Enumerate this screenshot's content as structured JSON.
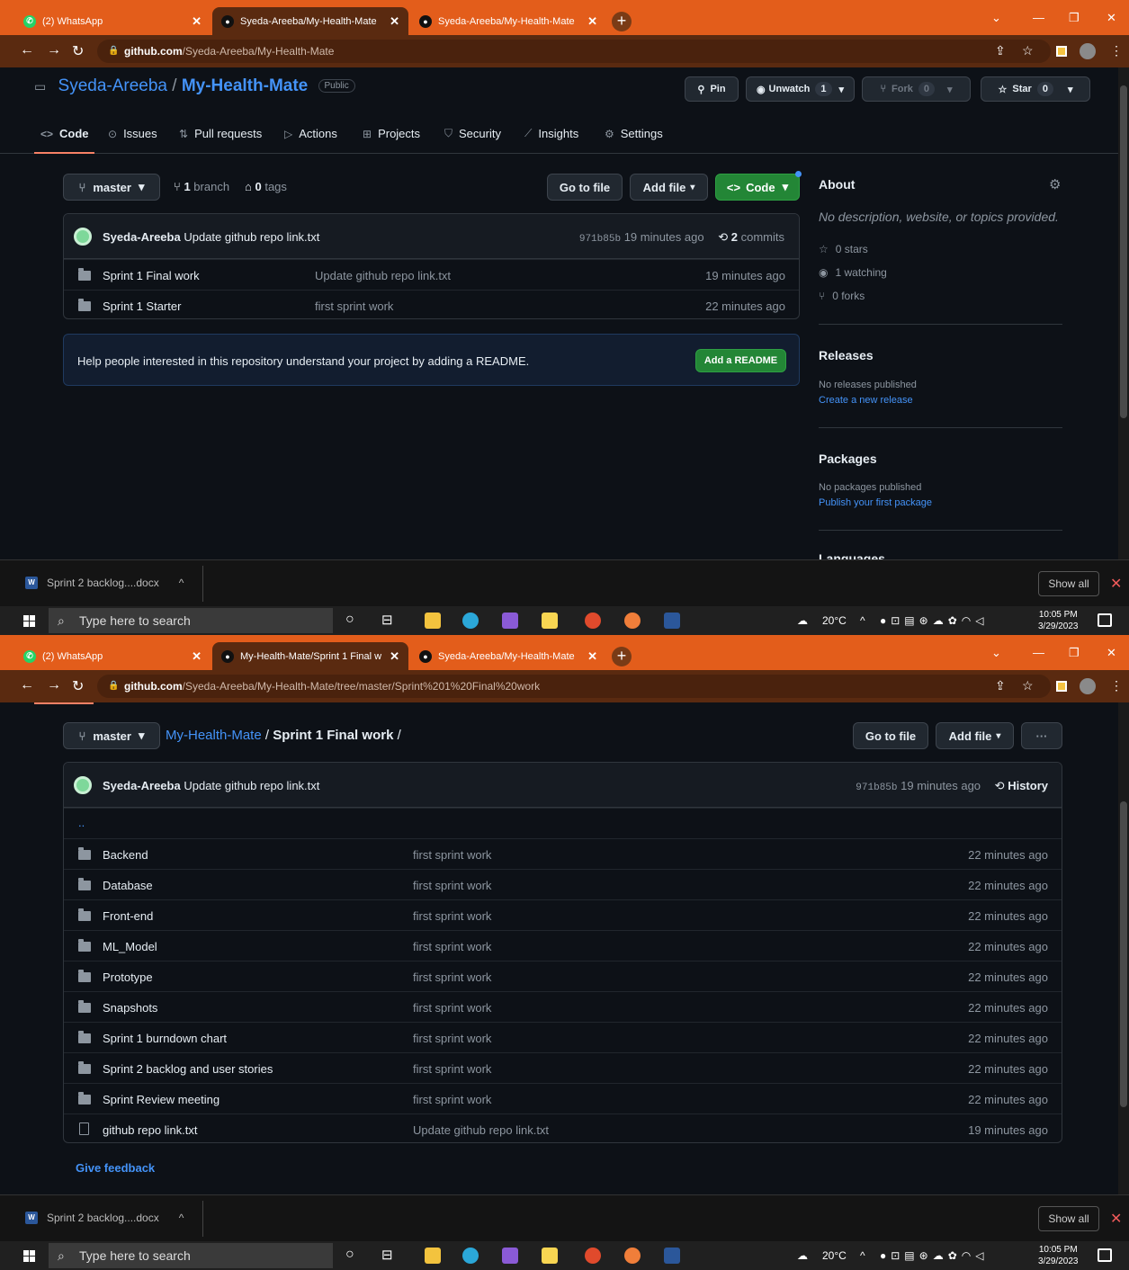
{
  "browser": {
    "tabs_shot1": [
      {
        "label": "(2) WhatsApp",
        "icon": "whatsapp-icon"
      },
      {
        "label": "Syeda-Areeba/My-Health-Mate",
        "icon": "github-icon"
      },
      {
        "label": "Syeda-Areeba/My-Health-Mate",
        "icon": "github-icon"
      }
    ],
    "tabs_shot2": [
      {
        "label": "(2) WhatsApp",
        "icon": "whatsapp-icon"
      },
      {
        "label": "My-Health-Mate/Sprint 1 Final w",
        "icon": "github-icon"
      },
      {
        "label": "Syeda-Areeba/My-Health-Mate",
        "icon": "github-icon"
      }
    ],
    "url1": {
      "host": "github.com",
      "path": "/Syeda-Areeba/My-Health-Mate"
    },
    "url2": {
      "host": "github.com",
      "path": "/Syeda-Areeba/My-Health-Mate/tree/master/Sprint%201%20Final%20work"
    }
  },
  "repo": {
    "owner": "Syeda-Areeba",
    "name": "My-Health-Mate",
    "visibility": "Public",
    "pin_label": "Pin",
    "unwatch_label": "Unwatch",
    "watch_count": "1",
    "fork_label": "Fork",
    "fork_count": "0",
    "star_label": "Star",
    "star_count": "0"
  },
  "repo_tabs": [
    "Code",
    "Issues",
    "Pull requests",
    "Actions",
    "Projects",
    "Security",
    "Insights",
    "Settings"
  ],
  "code_view": {
    "branch": "master",
    "branch_count": "1",
    "branch_label": "branch",
    "tag_count": "0",
    "tag_label": "tags",
    "go_to_file": "Go to file",
    "add_file": "Add file",
    "code_button": "Code",
    "latest_commit": {
      "author": "Syeda-Areeba",
      "message": "Update github repo link.txt",
      "sha": "971b85b",
      "time": "19 minutes ago",
      "commit_count": "2",
      "commits_label": "commits"
    },
    "files": [
      {
        "name": "Sprint 1 Final work",
        "message": "Update github repo link.txt",
        "age": "19 minutes ago"
      },
      {
        "name": "Sprint 1 Starter",
        "message": "first sprint work",
        "age": "22 minutes ago"
      }
    ],
    "readme_prompt": "Help people interested in this repository understand your project by adding a README.",
    "add_readme": "Add a README"
  },
  "about": {
    "title": "About",
    "description": "No description, website, or topics provided.",
    "stars": "0 stars",
    "watching": "1 watching",
    "forks": "0 forks",
    "releases_title": "Releases",
    "releases_none": "No releases published",
    "releases_link": "Create a new release",
    "packages_title": "Packages",
    "packages_none": "No packages published",
    "packages_link": "Publish your first package",
    "languages_partial": "Languages"
  },
  "folder_view": {
    "branch": "master",
    "breadcrumb_repo": "My-Health-Mate",
    "breadcrumb_sep": "/",
    "breadcrumb_folder": "Sprint 1 Final work",
    "go_to_file": "Go to file",
    "add_file": "Add file",
    "more": "···",
    "latest_commit": {
      "author": "Syeda-Areeba",
      "message": "Update github repo link.txt",
      "sha": "971b85b",
      "time": "19 minutes ago",
      "history": "History"
    },
    "parent": "..",
    "files": [
      {
        "name": "Backend",
        "type": "folder",
        "message": "first sprint work",
        "age": "22 minutes ago"
      },
      {
        "name": "Database",
        "type": "folder",
        "message": "first sprint work",
        "age": "22 minutes ago"
      },
      {
        "name": "Front-end",
        "type": "folder",
        "message": "first sprint work",
        "age": "22 minutes ago"
      },
      {
        "name": "ML_Model",
        "type": "folder",
        "message": "first sprint work",
        "age": "22 minutes ago"
      },
      {
        "name": "Prototype",
        "type": "folder",
        "message": "first sprint work",
        "age": "22 minutes ago"
      },
      {
        "name": "Snapshots",
        "type": "folder",
        "message": "first sprint work",
        "age": "22 minutes ago"
      },
      {
        "name": "Sprint 1 burndown chart",
        "type": "folder",
        "message": "first sprint work",
        "age": "22 minutes ago"
      },
      {
        "name": "Sprint 2 backlog and user stories",
        "type": "folder",
        "message": "first sprint work",
        "age": "22 minutes ago"
      },
      {
        "name": "Sprint Review meeting",
        "type": "folder",
        "message": "first sprint work",
        "age": "22 minutes ago"
      },
      {
        "name": "github repo link.txt",
        "type": "file",
        "message": "Update github repo link.txt",
        "age": "19 minutes ago"
      }
    ],
    "feedback": "Give feedback"
  },
  "downloads": {
    "item": "Sprint 2 backlog....docx",
    "show_all": "Show all"
  },
  "taskbar": {
    "search_placeholder": "Type here to search",
    "weather": "20°C",
    "time": "10:05 PM",
    "date": "3/29/2023"
  },
  "colors": {
    "tab_strip": "#e35d1b",
    "accent_green": "#238636",
    "link": "#4493f8"
  }
}
